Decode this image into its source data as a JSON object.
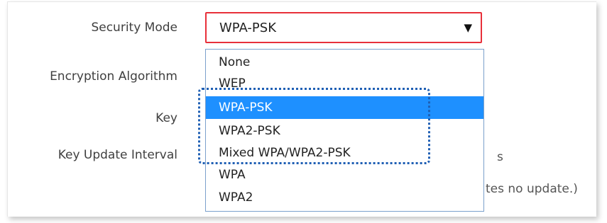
{
  "form": {
    "security_mode_label": "Security Mode",
    "encryption_algorithm_label": "Encryption Algorithm",
    "key_label": "Key",
    "key_update_interval_label": "Key Update Interval",
    "interval_unit": "s",
    "interval_note_partial": "tes no update.)"
  },
  "security_mode": {
    "selected": "WPA-PSK",
    "arrow_icon": "triangle-down",
    "options": [
      "None",
      "WEP",
      "WPA-PSK",
      "WPA2-PSK",
      "Mixed WPA/WPA2-PSK",
      "WPA",
      "WPA2"
    ],
    "highlighted_option": "WPA-PSK"
  },
  "colors": {
    "select_border": "#e8303a",
    "selected_option_bg": "#1e90ff",
    "annotation_box": "#1f5fb4"
  }
}
